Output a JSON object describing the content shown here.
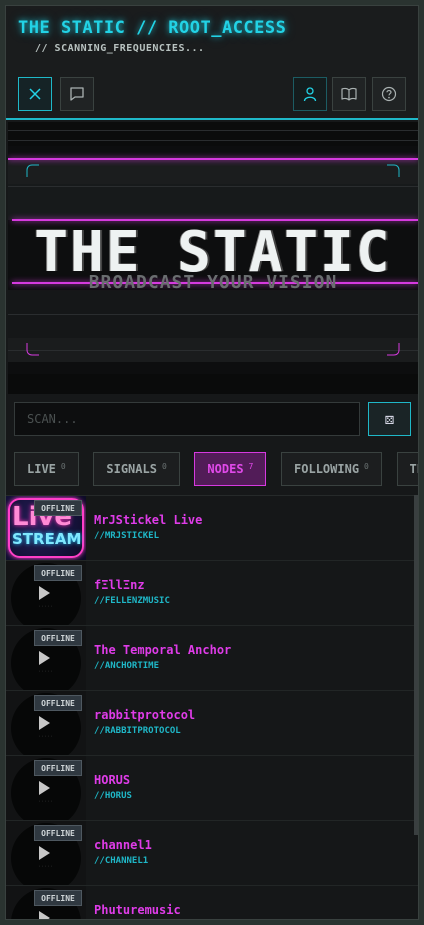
{
  "header": {
    "title": "THE STATIC // ROOT_ACCESS",
    "subtitle": "// SCANNING_FREQUENCIES..."
  },
  "toolbar": {
    "left": [
      {
        "icon": "close-icon",
        "active": true
      },
      {
        "icon": "chat-icon",
        "active": false
      }
    ],
    "right": [
      {
        "icon": "user-icon"
      },
      {
        "icon": "book-icon"
      },
      {
        "icon": "help-icon"
      }
    ]
  },
  "banner": {
    "title": "THE STATIC",
    "tagline": "BROADCAST YOUR VISION"
  },
  "search": {
    "placeholder": "SCAN...",
    "value": ""
  },
  "tabs": [
    {
      "label": "LIVE",
      "count": "0",
      "active": false
    },
    {
      "label": "SIGNALS",
      "count": "0",
      "active": false
    },
    {
      "label": "NODES",
      "count": "7",
      "active": true
    },
    {
      "label": "FOLLOWING",
      "count": "0",
      "active": false
    },
    {
      "label": "TERMINAL",
      "count": "",
      "active": false
    }
  ],
  "channels": [
    {
      "name": "MrJStickel Live",
      "handle": "//MRJSTICKEL",
      "status": "OFFLINE",
      "thumb": "live-stream-art"
    },
    {
      "name": "fΞllΞnz",
      "handle": "//FELLENZMUSIC",
      "status": "OFFLINE",
      "thumb": "default"
    },
    {
      "name": "The Temporal Anchor",
      "handle": "//ANCHORTIME",
      "status": "OFFLINE",
      "thumb": "default"
    },
    {
      "name": "rabbitprotocol",
      "handle": "//RABBITPROTOCOL",
      "status": "OFFLINE",
      "thumb": "default"
    },
    {
      "name": "HORUS",
      "handle": "//HORUS",
      "status": "OFFLINE",
      "thumb": "default"
    },
    {
      "name": "channel1",
      "handle": "//CHANNEL1",
      "status": "OFFLINE",
      "thumb": "default"
    },
    {
      "name": "Phuturemusic",
      "handle": "",
      "status": "OFFLINE",
      "thumb": "default"
    }
  ],
  "colors": {
    "accent_cyan": "#1fb8c8",
    "accent_magenta": "#df3ce8",
    "background": "#161819"
  }
}
